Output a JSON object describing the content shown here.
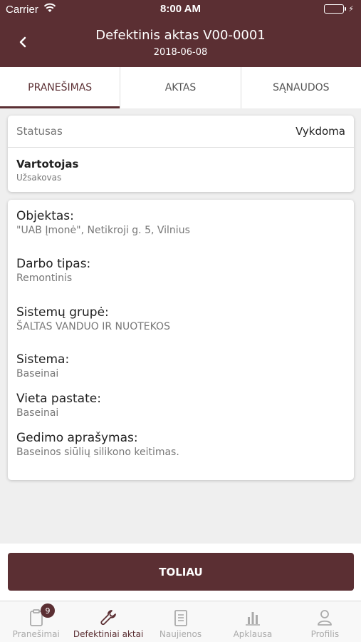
{
  "status_bar": {
    "carrier": "Carrier",
    "time": "8:00 AM"
  },
  "header": {
    "title": "Defektinis aktas V00-0001",
    "date": "2018-06-08"
  },
  "tabs": [
    {
      "label": "PRANEŠIMAS",
      "active": true
    },
    {
      "label": "AKTAS",
      "active": false
    },
    {
      "label": "SĄNAUDOS",
      "active": false
    }
  ],
  "status_card": {
    "status_label": "Statusas",
    "status_value": "Vykdoma",
    "user_title": "Vartotojas",
    "user_subtitle": "Užsakovas"
  },
  "details": [
    {
      "label": "Objektas:",
      "value": "\"UAB Įmonė\", Netikroji g. 5, Vilnius"
    },
    {
      "label": "Darbo tipas:",
      "value": "Remontinis"
    },
    {
      "label": "Sistemų grupė:",
      "value": "ŠALTAS VANDUO IR NUOTEKOS"
    },
    {
      "label": "Sistema:",
      "value": "Baseinai"
    },
    {
      "label": "Vieta pastate:",
      "value": "Baseinai"
    },
    {
      "label": "Gedimo aprašymas:",
      "value": "Baseinos siūlių silikono keitimas."
    }
  ],
  "next_button": "TOLIAU",
  "tabbar": {
    "items": [
      {
        "label": "Pranešimai",
        "icon": "clipboard-icon",
        "badge": "9"
      },
      {
        "label": "Defektiniai aktai",
        "icon": "wrench-icon"
      },
      {
        "label": "Naujienos",
        "icon": "news-icon"
      },
      {
        "label": "Apklausa",
        "icon": "bar-chart-icon"
      },
      {
        "label": "Profilis",
        "icon": "user-icon"
      }
    ]
  },
  "colors": {
    "primary": "#5b2f33",
    "battery": "#4cd964",
    "inactive": "#aaaaaa"
  }
}
